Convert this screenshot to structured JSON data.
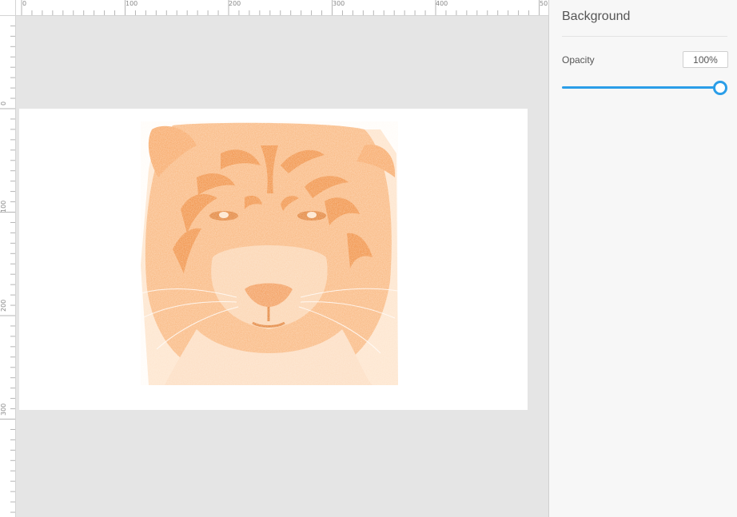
{
  "ruler": {
    "top_labels": [
      "0",
      "100",
      "200",
      "300",
      "400",
      "50"
    ],
    "left_labels": [
      "0",
      "100",
      "200",
      "300"
    ]
  },
  "canvas": {
    "artwork_icon": "tiger-face-image",
    "artwork_tint": "#f7a35f"
  },
  "panel": {
    "title": "Background",
    "opacity": {
      "label": "Opacity",
      "value": "100%",
      "level": 1.0
    },
    "accent_color": "#2b9ee8"
  }
}
